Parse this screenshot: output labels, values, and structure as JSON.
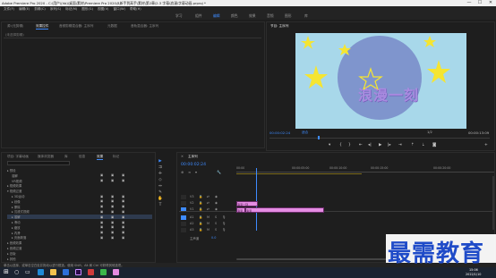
{
  "window": {
    "title": "Adobe Premiere Pro 2020 - C:\\用户\\(hb)\\桌面\\素材\\Premiere Pro 2020从新手到高手\\素材\\第2章\\2.3 字幕\\浪漫\\字幕动画.prproj *",
    "minimize": "—",
    "maximize": "☐",
    "close": "✕"
  },
  "menu": [
    "文件(F)",
    "编辑(E)",
    "剪辑(C)",
    "序列(S)",
    "标记(M)",
    "图形(G)",
    "视图(V)",
    "窗口(W)",
    "帮助(H)"
  ],
  "workspaces": [
    "学习",
    "组件",
    "编辑",
    "颜色",
    "效果",
    "音频",
    "图形",
    "库"
  ],
  "workspaces_active": 2,
  "source_panel": {
    "tabs": [
      "源:(无剪辑)",
      "效果控件",
      "音频剪辑混合器: 主序列",
      "元数据",
      "音轨混合器: 主序列"
    ],
    "active_tab": 1,
    "header": "(未选择剪辑)"
  },
  "program": {
    "title": "节目: 主序列",
    "timecode": "00:00:02:24",
    "fit": "适合",
    "quality": "1/2",
    "duration": "00:00:13:09",
    "overlay_text": "浪漫一刻"
  },
  "effects_panel": {
    "tabs": [
      "项目: 字幕动画",
      "媒体浏览器",
      "库",
      "信息",
      "效果",
      "标记"
    ],
    "active_tab": 4,
    "items": [
      {
        "label": "▸ 预设",
        "indent": 0
      },
      {
        "label": "溶解",
        "indent": 1
      },
      {
        "label": "VR视频",
        "indent": 1
      },
      {
        "label": "▸ 视频效果",
        "indent": 0
      },
      {
        "label": "▾ 视频过渡",
        "indent": 0
      },
      {
        "label": "▸ 3D运动",
        "indent": 1
      },
      {
        "label": "▸ 划像",
        "indent": 1
      },
      {
        "label": "▸ 擦除",
        "indent": 1
      },
      {
        "label": "▸ 沉浸式视频",
        "indent": 1
      },
      {
        "label": "▸ 溶解",
        "indent": 1
      },
      {
        "label": "▸ 滑动",
        "indent": 1
      },
      {
        "label": "▸ 缩放",
        "indent": 1
      },
      {
        "label": "▸ 内滑",
        "indent": 1
      },
      {
        "label": "▸ 页面剥落",
        "indent": 1
      },
      {
        "label": "▸ 音频效果",
        "indent": 0
      },
      {
        "label": "▸ 音频过渡",
        "indent": 0
      },
      {
        "label": "▸ 旧版",
        "indent": 0
      },
      {
        "label": "▸ 其他",
        "indent": 0
      }
    ],
    "selected_index": 9
  },
  "timeline": {
    "title": "主序列",
    "timecode": "00:00:02:24",
    "ruler": [
      "00:00",
      "00:00:05:00",
      "00:00:10:00",
      "00:00:15:00",
      "00:00:20:00"
    ],
    "tracks": [
      "V3",
      "V2",
      "V1",
      "A1",
      "A2",
      "A3",
      "主声道"
    ],
    "master_value": "0.0",
    "clips": [
      {
        "label": "浪漫一刻"
      },
      {
        "label": "浪漫"
      },
      {
        "label": "浪漫"
      }
    ]
  },
  "status_bar": "单击以选择，或单击空白处并拖动以进行框选。使用 Shift、Alt 和 Ctrl 可获得其他选项。",
  "watermark": "最需教育",
  "taskbar": {
    "time": "15:06",
    "date": "2022/1/10"
  },
  "colors": {
    "accent": "#3e8bff",
    "monitor_bg": "#a8d8ea",
    "clip_pink": "#e58de3",
    "star": "#f5e531"
  }
}
